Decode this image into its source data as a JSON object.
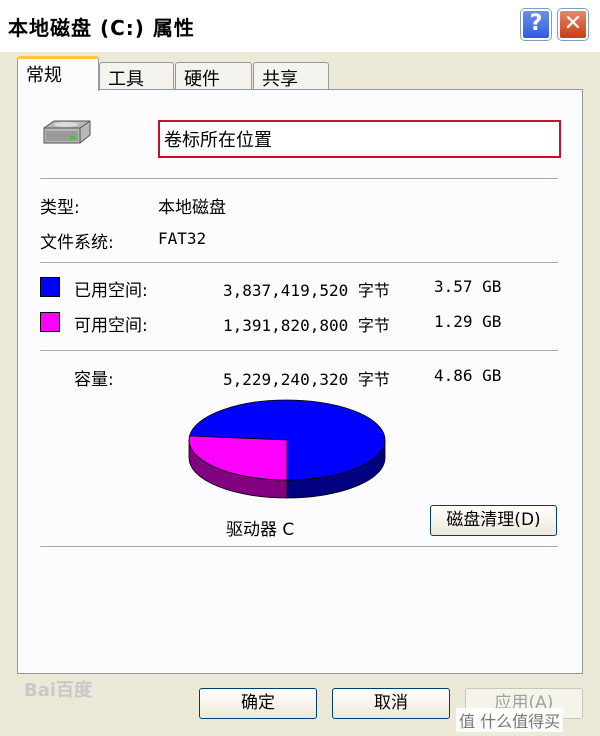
{
  "window": {
    "title": "本地磁盘 (C:) 属性",
    "help_label": "?",
    "close_label": "✕"
  },
  "tabs": [
    {
      "label": "常规",
      "active": true
    },
    {
      "label": "工具",
      "active": false
    },
    {
      "label": "硬件",
      "active": false
    },
    {
      "label": "共享",
      "active": false
    }
  ],
  "general": {
    "volume_label_value": "卷标所在位置",
    "type_label": "类型:",
    "type_value": "本地磁盘",
    "fs_label": "文件系统:",
    "fs_value": "FAT32",
    "used_label": "已用空间:",
    "used_bytes": "3,837,419,520 字节",
    "used_gb": "3.57 GB",
    "free_label": "可用空间:",
    "free_bytes": "1,391,820,800 字节",
    "free_gb": "1.29 GB",
    "capacity_label": "容量:",
    "capacity_bytes": "5,229,240,320 字节",
    "capacity_gb": "4.86 GB",
    "drive_label": "驱动器 C",
    "cleanup_label": "磁盘清理(D)"
  },
  "colors": {
    "used": "#0000ff",
    "free": "#ff00ff",
    "used_side": "#000080",
    "free_side": "#800080"
  },
  "pie": {
    "used_fraction": 0.734,
    "free_fraction": 0.266
  },
  "buttons": {
    "ok_label": "确定",
    "cancel_label": "取消",
    "apply_label": "应用(A)"
  },
  "watermarks": {
    "left": "Bai百度",
    "right": "值 什么值得买"
  }
}
